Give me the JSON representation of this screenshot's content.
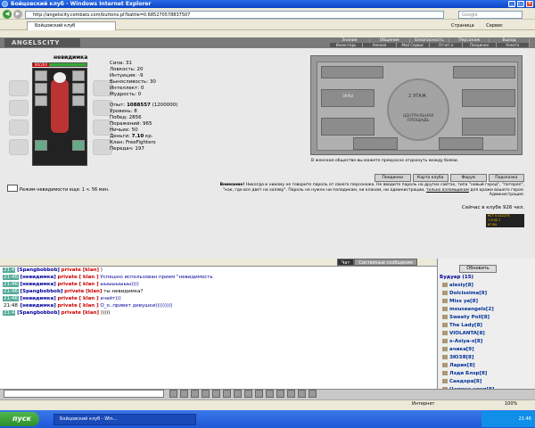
{
  "window": {
    "title": "Бойцовский клуб - Windows Internet Explorer"
  },
  "address": {
    "url": "http://angelscity.combats.com/buttons.pl?battle=0.685270578837507",
    "search_placeholder": "Google"
  },
  "tab": {
    "label": "Бойцовский клуб"
  },
  "toolbar": {
    "page": "Страница",
    "tools": "Сервис"
  },
  "game": {
    "logo": "ANGELSCITY",
    "menu_top": [
      "Знание",
      "Общение",
      "Безопасность",
      "Персонаж",
      "Выход"
    ],
    "menu_bottom": [
      "Инвентарь",
      "Умения",
      "Мой Сервис",
      "Отчет о переводах",
      "Поединки",
      "Анкета"
    ]
  },
  "character": {
    "name": "невидимка",
    "hp": "80/260",
    "stats": {
      "strength": "Сила: 31",
      "agility": "Ловкость: 20",
      "intuition": "Интуиция: -9",
      "endurance": "Выносливость: 30",
      "intellect": "Интеллект: 0",
      "wisdom": "Мудрость: 0",
      "exp_label": "Опыт: ",
      "exp": "1088557",
      "exp_next": "(1200000)",
      "level": "Уровень: 8",
      "wins": "Побед: 2856",
      "losses": "Поражений: 965",
      "draws": "Ничьих: 50",
      "money_label": "Деньги: ",
      "money": "7.10",
      "money_unit": " кр.",
      "clan": "Клан: FreeFighters",
      "transfers": "Передач: 197"
    }
  },
  "map": {
    "floor": "2 ЭТАЖ",
    "central": "ЦЕНТРАЛЬНАЯ ПЛОЩАДЬ",
    "halls": "ЗАЛЫ",
    "tip": "В женском обществе вы можете прекрасно отдохнуть между боями."
  },
  "nav_buttons": [
    "Поединки",
    "Карта клуба",
    "Форум",
    "Подсказка"
  ],
  "warning": {
    "lead": "Внимание!",
    "text": "Никогда и никому не говорите пароль от своего персонажа. Не вводите пароль на других сайтах, типа \"новый город\", \"потерял\", \"как, где все двет на халяву\". Пароль не нужен ни паладинам, ни кланам, ни администрации,",
    "link": "только взломщикам",
    "tail": "для кражи вашего героя.",
    "sign": "Администрация."
  },
  "online": "Сейчас в клубе 926 чел.",
  "counter": [
    "RCT 0.442275",
    "7.9 02.7",
    "67.64"
  ],
  "invisibility": "Режим невидимости еще: 1 ч. 56 мин.",
  "chat": {
    "tabs": [
      "Чат",
      "Системные сообщения"
    ],
    "messages": [
      {
        "time": "21:4",
        "user": "[Spangbobbob]",
        "priv": "private [klan]",
        "text": " )"
      },
      {
        "time": "21:46",
        "user": "[невидимка]",
        "priv": "private [ klan ]",
        "text": " Успешно использован прием \"невидимость"
      },
      {
        "time": "21:46",
        "user": "[невидимка]",
        "priv": "private [ klan ]",
        "text": " ыыыыыыыы))))"
      },
      {
        "time": "21:46",
        "user": "[Spangbobbob]",
        "priv": "private [klan]",
        "text": " ты невидимка?"
      },
      {
        "time": "21:46",
        "user": "[невидимка]",
        "priv": "private [ klan ]",
        "text": " ачайт)))"
      },
      {
        "time": "21:48",
        "user": "[невидимка]",
        "priv": "private [ klan ]",
        "text": " О_о..привет девушки)))))))))"
      },
      {
        "time": "21:4",
        "user": "[Spangbobbob]",
        "priv": "private [klan]",
        "text": " )))))"
      }
    ]
  },
  "users": {
    "refresh": "Обновить",
    "room": "Будуар (15)",
    "list": [
      "alesiy[8]",
      "Dolcissima[8]",
      "Miss ya[8]",
      "mouseangels[2]",
      "Sweety Poll[8]",
      "The Lady[8]",
      "VIOLANTA[8]",
      "x-Asiya-x[8]",
      "ачика[9]",
      "ЗЮЗЯ[8]",
      "Ларик[8]",
      "Лэди Блэр[8]",
      "Сандора[8]",
      "Царица ночи[8]"
    ]
  },
  "status": {
    "zone": "Интернет",
    "zoom": "100%"
  },
  "taskbar": {
    "start": "пуск",
    "item": "Бойцовский клуб - Win...",
    "clock": "21:46"
  }
}
